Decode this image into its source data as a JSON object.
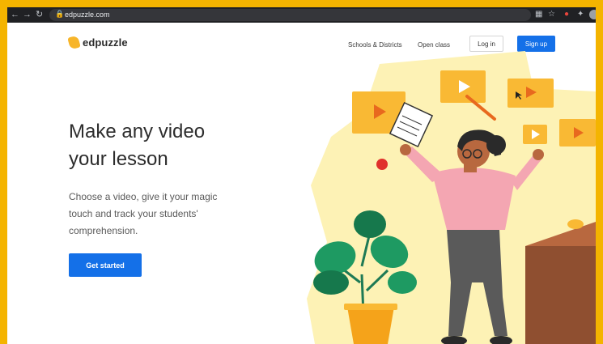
{
  "browser": {
    "back_icon": "back-arrow-icon",
    "forward_icon": "forward-arrow-icon",
    "reload_icon": "reload-icon",
    "url": "edpuzzle.com"
  },
  "header": {
    "logo_text": "edpuzzle",
    "nav": [
      "Schools & Districts",
      "Open class"
    ],
    "login_label": "Log in",
    "signup_label": "Sign up"
  },
  "hero": {
    "headline_line1": "Make any video",
    "headline_line2": "your lesson",
    "sub_line1": "Choose a video, give it your magic",
    "sub_line2": "touch and track your students'",
    "sub_line3": "comprehension.",
    "cta_label": "Get started"
  },
  "colors": {
    "accent": "#1470e8",
    "brand_yellow": "#f7b52a",
    "frame": "#f4b400"
  }
}
